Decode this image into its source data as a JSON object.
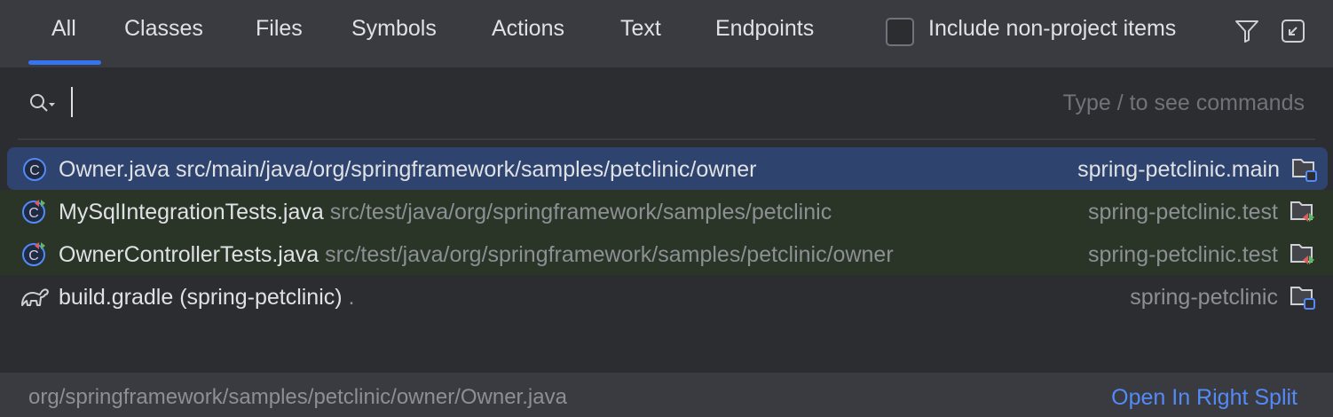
{
  "tabs": [
    {
      "label": "All"
    },
    {
      "label": "Classes"
    },
    {
      "label": "Files"
    },
    {
      "label": "Symbols"
    },
    {
      "label": "Actions"
    },
    {
      "label": "Text"
    },
    {
      "label": "Endpoints"
    }
  ],
  "include_non_project": {
    "label": "Include non-project items",
    "checked": false
  },
  "search": {
    "value": "",
    "hint": "Type / to see commands"
  },
  "results": [
    {
      "name": "Owner.java",
      "path": "src/main/java/org/springframework/samples/petclinic/owner",
      "module": "spring-petclinic.main",
      "icon": "class-icon"
    },
    {
      "name": "MySqlIntegrationTests.java",
      "path": "src/test/java/org/springframework/samples/petclinic",
      "module": "spring-petclinic.test",
      "icon": "test-class-icon"
    },
    {
      "name": "OwnerControllerTests.java",
      "path": "src/test/java/org/springframework/samples/petclinic/owner",
      "module": "spring-petclinic.test",
      "icon": "test-class-icon"
    },
    {
      "name": "build.gradle (spring-petclinic)",
      "path": ".",
      "module": "spring-petclinic",
      "icon": "gradle-icon"
    }
  ],
  "footer": {
    "path": "org/springframework/samples/petclinic/owner/Owner.java",
    "action": "Open In Right Split"
  }
}
